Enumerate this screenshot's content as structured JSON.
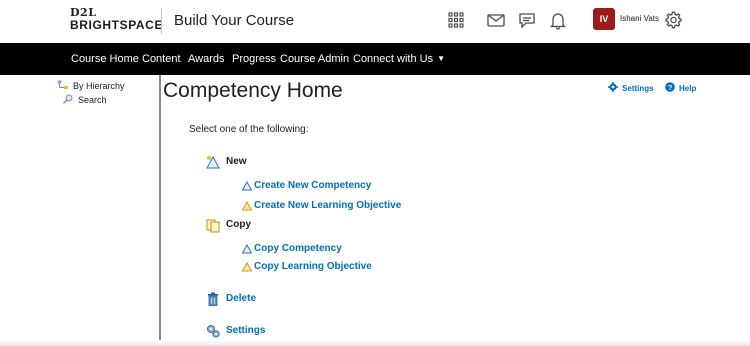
{
  "header": {
    "logo_top": "D2L",
    "logo_bottom": "BRIGHTSPACE",
    "course_title": "Build Your Course",
    "icons": [
      "app-grid-icon",
      "mail-icon",
      "chat-icon",
      "bell-icon",
      "gear-icon"
    ],
    "user_initials": "IV",
    "user_name": "Ishani Vats",
    "avatar_color": "#9e1a1a"
  },
  "nav": {
    "items": [
      "Course Home",
      "Content",
      "Awards",
      "Progress",
      "Course Admin",
      "Connect with Us"
    ],
    "background": "#000000"
  },
  "left_pane": {
    "items": [
      {
        "label": "By Hierarchy",
        "icon": "hierarchy-icon"
      },
      {
        "label": "Search",
        "icon": "search-icon"
      }
    ]
  },
  "main": {
    "title": "Competency Home",
    "settings_link": "Settings",
    "help_link": "Help",
    "instruction": "Select one of the following:",
    "new_section": {
      "label": "New",
      "actions": [
        "Create New Competency",
        "Create New Learning Objective"
      ]
    },
    "copy_section": {
      "label": "Copy",
      "actions": [
        "Copy Competency",
        "Copy Learning Objective"
      ]
    },
    "delete_label": "Delete",
    "settings_label": "Settings"
  },
  "colors": {
    "link": "#006fbf",
    "text": "#202122"
  }
}
